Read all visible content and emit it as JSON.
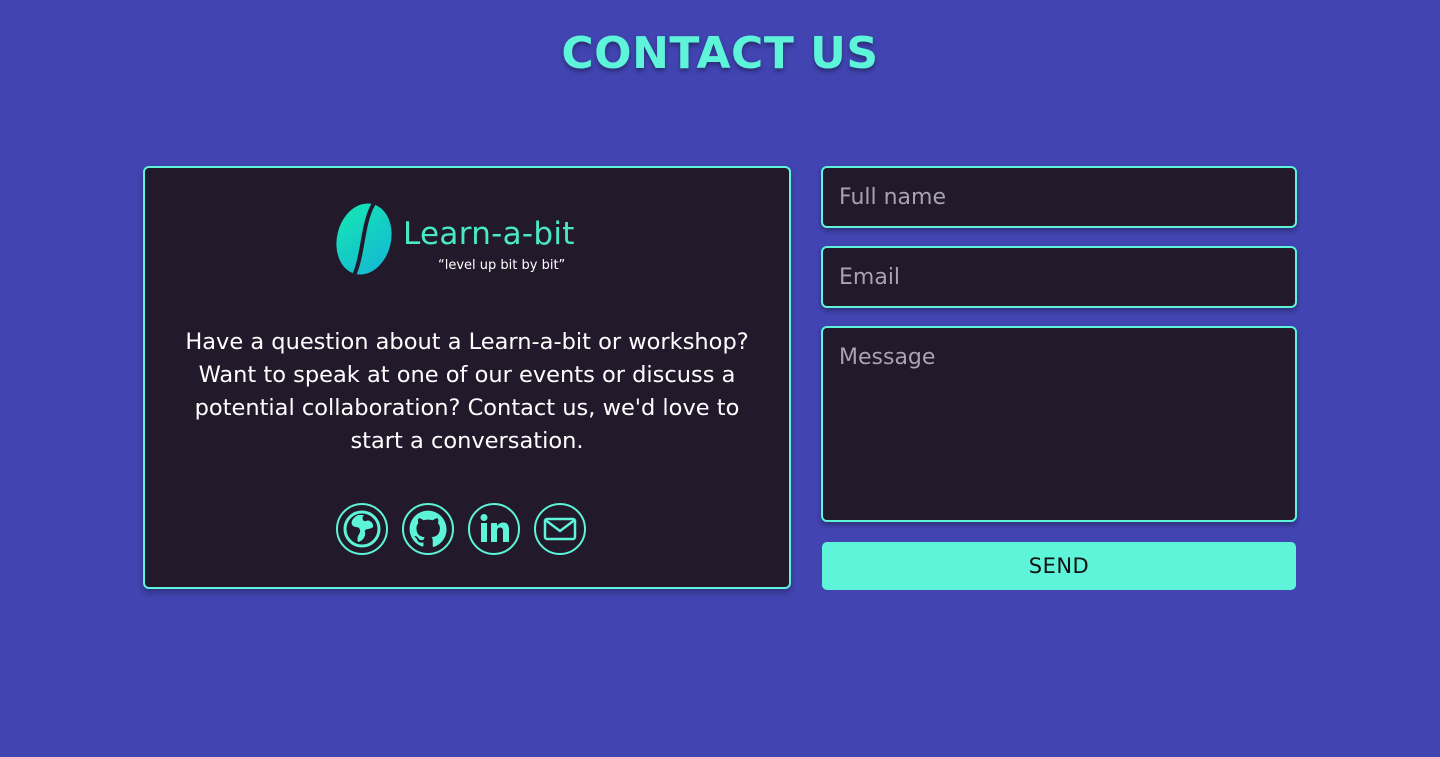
{
  "page": {
    "title": "CONTACT US"
  },
  "brand": {
    "name": "Learn-a-bit",
    "tagline": "“level up bit by bit”"
  },
  "info": {
    "text": "Have a question about a Learn-a-bit or workshop? Want to speak at one of our events or discuss a potential collaboration? Contact us, we'd love to start a conversation."
  },
  "social": [
    {
      "icon": "globe-icon"
    },
    {
      "icon": "github-icon"
    },
    {
      "icon": "linkedin-icon"
    },
    {
      "icon": "mail-icon"
    }
  ],
  "form": {
    "name_placeholder": "Full name",
    "email_placeholder": "Email",
    "message_placeholder": "Message",
    "send_label": "SEND"
  },
  "colors": {
    "background": "#4144b1",
    "accent": "#5ef4d9",
    "card": "#221a2b",
    "text": "#ffffff",
    "placeholder": "#a8a3ae"
  }
}
